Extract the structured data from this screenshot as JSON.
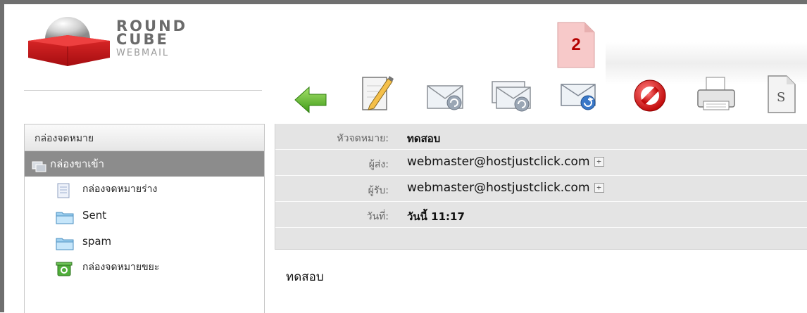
{
  "logo": {
    "line1": "ROUND",
    "line2": "CUBE",
    "line3": "WEBMAIL"
  },
  "toolbar": {
    "buttons": [
      {
        "name": "back",
        "icon": "back-arrow-icon"
      },
      {
        "name": "compose",
        "icon": "compose-icon"
      },
      {
        "name": "reply",
        "icon": "reply-icon"
      },
      {
        "name": "reply-all",
        "icon": "reply-all-icon"
      },
      {
        "name": "forward",
        "icon": "forward-icon"
      },
      {
        "name": "delete",
        "icon": "delete-icon"
      },
      {
        "name": "print",
        "icon": "print-icon"
      },
      {
        "name": "source",
        "icon": "source-icon"
      }
    ],
    "badge": "2"
  },
  "sidebar": {
    "header": "กล่องจดหมาย",
    "items": [
      {
        "label": "กล่องขาเข้า",
        "icon": "inbox-icon"
      },
      {
        "label": "กล่องจดหมายร่าง",
        "icon": "drafts-icon"
      },
      {
        "label": "Sent",
        "icon": "folder-icon"
      },
      {
        "label": "spam",
        "icon": "folder-icon"
      },
      {
        "label": "กล่องจดหมายขยะ",
        "icon": "trash-icon"
      }
    ]
  },
  "message": {
    "subject_label": "หัวจดหมาย:",
    "subject": "ทดสอบ",
    "from_label": "ผู้ส่ง:",
    "from": "webmaster@hostjustclick.com",
    "to_label": "ผู้รับ:",
    "to": "webmaster@hostjustclick.com",
    "date_label": "วันที่:",
    "date": "วันนี้ 11:17",
    "body": "ทดสอบ"
  },
  "colors": {
    "accent": "#d0181b",
    "selected": "#8c8c8c",
    "header_bg": "#e4e4e4"
  }
}
